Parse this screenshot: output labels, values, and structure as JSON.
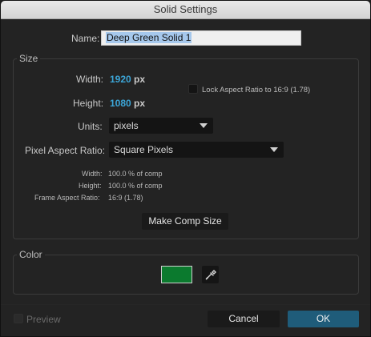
{
  "window": {
    "title": "Solid Settings"
  },
  "name": {
    "label": "Name:",
    "value": "Deep Green Solid 1"
  },
  "size": {
    "title": "Size",
    "width_label": "Width:",
    "width_value": "1920",
    "width_unit": "px",
    "height_label": "Height:",
    "height_value": "1080",
    "height_unit": "px",
    "lock_aspect_label": "Lock Aspect Ratio to 16:9 (1.78)",
    "lock_aspect_checked": false,
    "units_label": "Units:",
    "units_value": "pixels",
    "pixel_aspect_label": "Pixel Aspect Ratio:",
    "pixel_aspect_value": "Square Pixels",
    "info": {
      "width_label": "Width:",
      "width_value": "100.0 % of comp",
      "height_label": "Height:",
      "height_value": "100.0 % of comp",
      "frame_aspect_label": "Frame Aspect Ratio:",
      "frame_aspect_value": "16:9 (1.78)"
    },
    "make_comp_size_button": "Make Comp Size"
  },
  "color": {
    "title": "Color",
    "swatch_hex": "#0b7a2e"
  },
  "footer": {
    "preview_label": "Preview",
    "preview_checked": false,
    "cancel_button": "Cancel",
    "ok_button": "OK"
  },
  "colors": {
    "accent_blue": "#3ca6d8",
    "primary_button": "#1f5c7a"
  }
}
